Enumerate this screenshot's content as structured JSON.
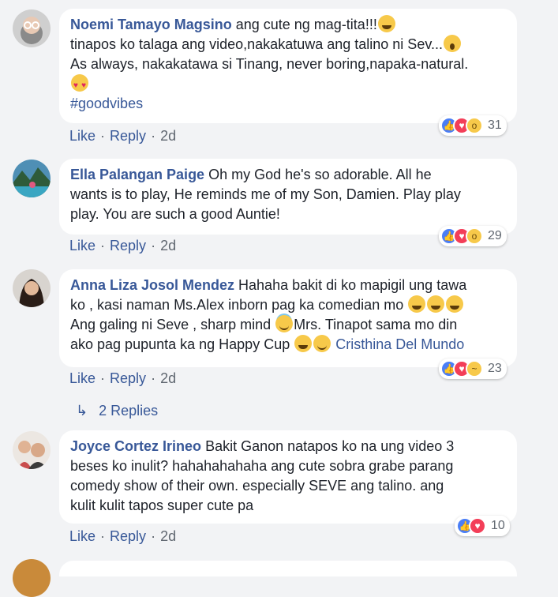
{
  "comments": [
    {
      "name": "Noemi Tamayo Magsino",
      "text1": " ang cute ng mag-tita!!!",
      "text2": "tinapos ko talaga ang video,nakakatuwa ang talino ni Sev...",
      "text3": "As always, nakakatawa si Tinang, never boring,napaka-natural.",
      "hashtag": "#goodvibes",
      "reactions": "31",
      "like": "Like",
      "reply": "Reply",
      "time": "2d"
    },
    {
      "name": "Ella Palangan Paige",
      "text1": " Oh my God he's so adorable. All he",
      "text2": "wants is to play, He reminds me of my Son, Damien. Play play",
      "text3": "play. You are such a good Auntie!",
      "reactions": "29",
      "like": "Like",
      "reply": "Reply",
      "time": "2d"
    },
    {
      "name": "Anna Liza Josol Mendez",
      "text1": " Hahaha bakit di ko mapigil ung tawa",
      "text2": "ko , kasi naman Ms.Alex inborn pag ka comedian mo",
      "text3a": "Ang galing ni Seve , sharp mind",
      "text3b": "Mrs. Tinapot sama mo din",
      "text4": "ako pag pupunta ka ng Happy Cup",
      "tag": "Cristhina Del Mundo",
      "reactions": "23",
      "like": "Like",
      "reply": "Reply",
      "time": "2d",
      "replies_label": "2 Replies"
    },
    {
      "name": "Joyce Cortez Irineo",
      "text1": " Bakit Ganon natapos ko na ung video 3",
      "text2": "beses ko inulit? hahahahahaha ang cute sobra grabe parang",
      "text3": "comedy show of their own. especially SEVE ang talino. ang",
      "text4": "kulit kulit tapos super cute pa",
      "reactions": "10",
      "like": "Like",
      "reply": "Reply",
      "time": "2d"
    }
  ],
  "colors": {
    "name": "#385898",
    "text": "#1d2129",
    "meta": "#606770",
    "background": "#f2f3f5",
    "like": "#4a7ef6",
    "love": "#f33e58",
    "emoji": "#f7c94a"
  }
}
